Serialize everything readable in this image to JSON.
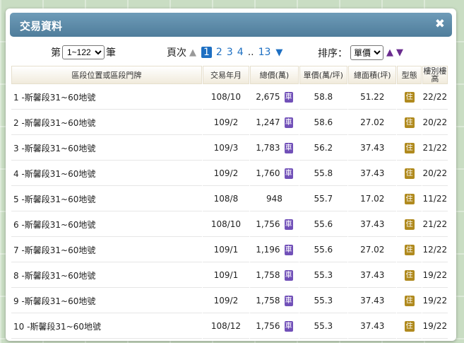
{
  "dialog": {
    "title": "交易資料",
    "close": "✖"
  },
  "paging": {
    "prefix": "第",
    "suffix": "筆",
    "range_selected": "1~122",
    "label": "頁次",
    "pages": [
      "1",
      "2",
      "3",
      "4",
      "13"
    ],
    "dots": "..",
    "next_icon": "▼"
  },
  "sort": {
    "label": "排序：",
    "selected": "單價",
    "asc_icon": "▲",
    "desc_icon": "▼"
  },
  "table": {
    "headers": {
      "addr": "區段位置或區段門牌",
      "date": "交易年月",
      "price": "總價(萬)",
      "unit": "單價(萬/坪)",
      "area": "總面積(坪)",
      "type": "型態",
      "floor": "樓別樓高"
    },
    "rows": [
      {
        "addr": "1 -斯馨段31~60地號",
        "date": "108/10",
        "price": "2,675",
        "car": true,
        "unit": "58.8",
        "area": "51.22",
        "type": "住",
        "floor": "22/22"
      },
      {
        "addr": "2 -斯馨段31~60地號",
        "date": "109/2",
        "price": "1,247",
        "car": true,
        "unit": "58.6",
        "area": "27.02",
        "type": "住",
        "floor": "20/22"
      },
      {
        "addr": "3 -斯馨段31~60地號",
        "date": "109/3",
        "price": "1,783",
        "car": true,
        "unit": "56.2",
        "area": "37.43",
        "type": "住",
        "floor": "21/22"
      },
      {
        "addr": "4 -斯馨段31~60地號",
        "date": "109/2",
        "price": "1,760",
        "car": true,
        "unit": "55.8",
        "area": "37.43",
        "type": "住",
        "floor": "20/22"
      },
      {
        "addr": "5 -斯馨段31~60地號",
        "date": "108/8",
        "price": "948",
        "car": false,
        "unit": "55.7",
        "area": "17.02",
        "type": "住",
        "floor": "11/22"
      },
      {
        "addr": "6 -斯馨段31~60地號",
        "date": "108/10",
        "price": "1,756",
        "car": true,
        "unit": "55.6",
        "area": "37.43",
        "type": "住",
        "floor": "21/22"
      },
      {
        "addr": "7 -斯馨段31~60地號",
        "date": "109/1",
        "price": "1,196",
        "car": true,
        "unit": "55.6",
        "area": "27.02",
        "type": "住",
        "floor": "12/22"
      },
      {
        "addr": "8 -斯馨段31~60地號",
        "date": "109/1",
        "price": "1,758",
        "car": true,
        "unit": "55.3",
        "area": "37.43",
        "type": "住",
        "floor": "19/22"
      },
      {
        "addr": "9 -斯馨段31~60地號",
        "date": "109/2",
        "price": "1,758",
        "car": true,
        "unit": "55.3",
        "area": "37.43",
        "type": "住",
        "floor": "19/22"
      },
      {
        "addr": "10 -斯馨段31~60地號",
        "date": "108/12",
        "price": "1,756",
        "car": true,
        "unit": "55.3",
        "area": "37.43",
        "type": "住",
        "floor": "19/22"
      }
    ],
    "car_glyph": "車"
  },
  "colors": {
    "title_bar": "#5a89a8",
    "accent_link": "#1d6fc2",
    "car_badge": "#7150b8",
    "type_badge": "#b08a1e",
    "sort_arrow": "#6a2c8f"
  }
}
